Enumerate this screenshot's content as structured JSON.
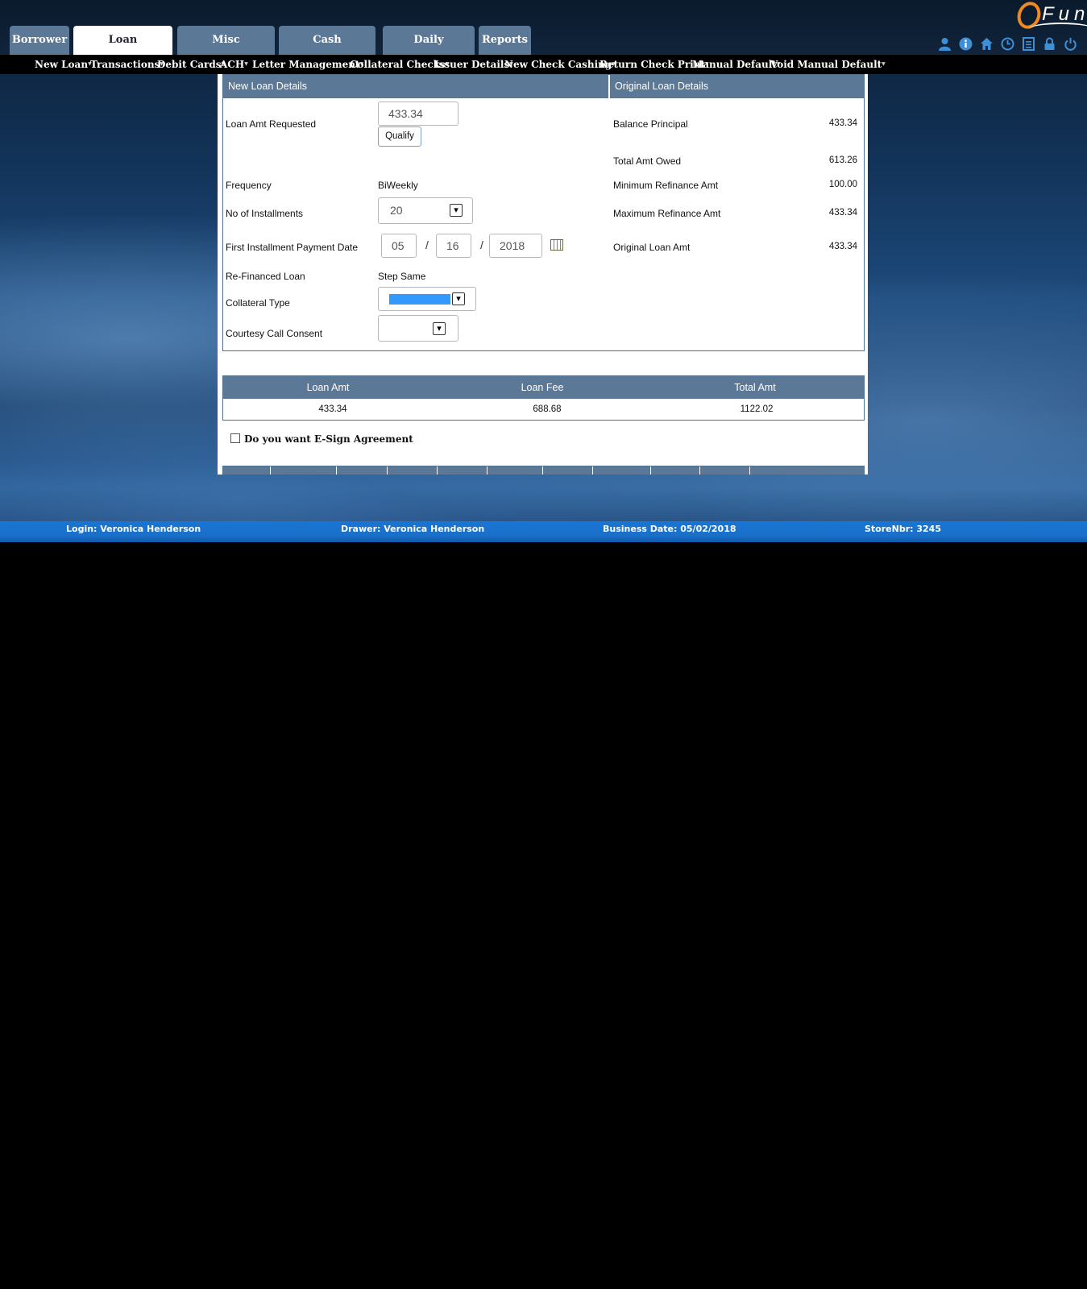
{
  "logo": {
    "text": "Fun"
  },
  "main_tabs": [
    {
      "label": "Borrower",
      "active": false
    },
    {
      "label": "Loan Transactions",
      "active": true
    },
    {
      "label": "Misc Transactions",
      "active": false
    },
    {
      "label": "Cash Management",
      "active": false
    },
    {
      "label": "Daily Processing",
      "active": false
    },
    {
      "label": "Reports",
      "active": false
    }
  ],
  "toolbar_icons": [
    "user-icon",
    "info-icon",
    "home-icon",
    "clock-icon",
    "document-icon",
    "lock-icon",
    "power-icon"
  ],
  "submenu": [
    {
      "label": "New Loan"
    },
    {
      "label": "Transactions"
    },
    {
      "label": "Debit Cards"
    },
    {
      "label": "ACH"
    },
    {
      "label": "Letter Management"
    },
    {
      "label": "Collateral Checks"
    },
    {
      "label": "Issuer Details"
    },
    {
      "label": "New Check Cashing"
    },
    {
      "label": "Return Check Print"
    },
    {
      "label": "Manual Default"
    },
    {
      "label": "Void Manual Default"
    }
  ],
  "new_loan": {
    "header": "New Loan Details",
    "loan_amt_label": "Loan Amt Requested",
    "loan_amt_value": "433.34",
    "qualify_label": "Qualify",
    "frequency_label": "Frequency",
    "frequency_value": "BiWeekly",
    "installments_label": "No of Installments",
    "installments_value": "20",
    "first_payment_label": "First Installment Payment Date",
    "first_payment_month": "05",
    "first_payment_day": "16",
    "first_payment_year": "2018",
    "date_sep": "/",
    "refinanced_label": "Re-Financed Loan",
    "refinanced_value": "Step Same",
    "collateral_label": "Collateral Type",
    "collateral_value": "",
    "courtesy_label": "Courtesy Call Consent",
    "courtesy_value": ""
  },
  "original_loan": {
    "header": "Original Loan Details",
    "rows": [
      {
        "label": "Balance Principal",
        "value": "433.34"
      },
      {
        "label": "Total Amt Owed",
        "value": "613.26"
      },
      {
        "label": "Minimum Refinance Amt",
        "value": "100.00"
      },
      {
        "label": "Maximum Refinance Amt",
        "value": "433.34"
      },
      {
        "label": "Original Loan Amt",
        "value": "433.34"
      }
    ]
  },
  "summary": {
    "headers": [
      "Loan Amt",
      "Loan Fee",
      "Total Amt"
    ],
    "values": [
      "433.34",
      "688.68",
      "1122.02"
    ]
  },
  "esign": {
    "label": "Do you want E-Sign Agreement",
    "checked": false
  },
  "status_bar": {
    "login": "Login: Veronica Henderson",
    "drawer": "Drawer: Veronica Henderson",
    "business_date": "Business Date: 05/02/2018",
    "store": "StoreNbr: 3245"
  },
  "colors": {
    "tab_bg": "#5b7896",
    "header_bg": "#5b7896",
    "status_bar": "#1876d4",
    "icon_blue": "#3f8fd6",
    "logo_orange": "#f08a1e",
    "select_highlight": "#3399ff"
  }
}
